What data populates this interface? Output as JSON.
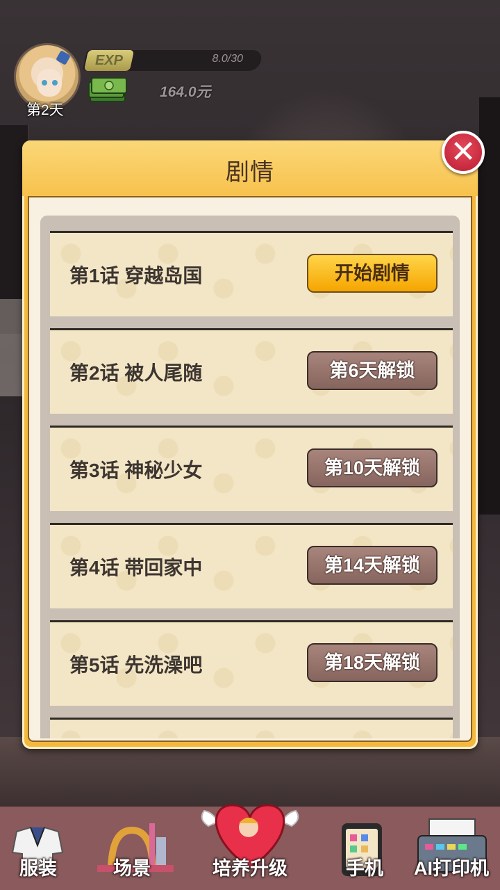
{
  "hud": {
    "day": "第2天",
    "exp_label": "EXP",
    "exp_value": "8.0/30",
    "money": "164.0元"
  },
  "modal": {
    "title": "剧情",
    "close_icon": "close-x-icon",
    "episodes": [
      {
        "title": "第1话 穿越岛国",
        "button": "开始剧情",
        "state": "start"
      },
      {
        "title": "第2话 被人尾随",
        "button": "第6天解锁",
        "state": "locked"
      },
      {
        "title": "第3话 神秘少女",
        "button": "第10天解锁",
        "state": "locked"
      },
      {
        "title": "第4话 带回家中",
        "button": "第14天解锁",
        "state": "locked"
      },
      {
        "title": "第5话 先洗澡吧",
        "button": "第18天解锁",
        "state": "locked"
      }
    ]
  },
  "nav": {
    "items": [
      {
        "label": "服装",
        "icon": "uniform-icon"
      },
      {
        "label": "场景",
        "icon": "city-scene-icon"
      },
      {
        "label": "培养升级",
        "icon": "heart-cupid-icon"
      },
      {
        "label": "手机",
        "icon": "phone-icon"
      },
      {
        "label": "AI打印机",
        "icon": "printer-icon"
      }
    ]
  },
  "colors": {
    "modal_frame": "#f3b93e",
    "start_button": "#f5a500",
    "locked_button": "#86655e",
    "close_button": "#d2283e",
    "nav_bar": "#8a5a5c"
  }
}
